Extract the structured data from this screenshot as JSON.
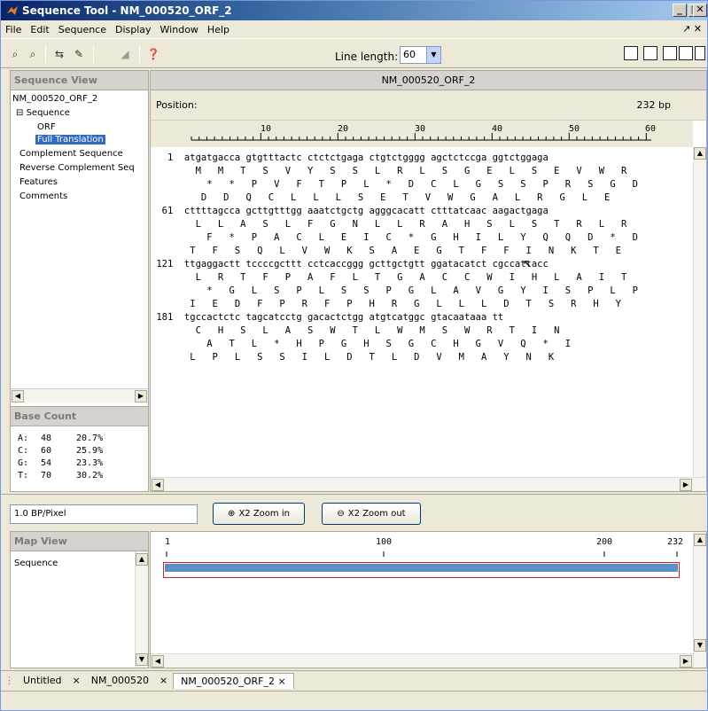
{
  "window": {
    "title": "Sequence Tool - NM_000520_ORF_2"
  },
  "menu": [
    "File",
    "Edit",
    "Sequence",
    "Display",
    "Window",
    "Help"
  ],
  "menu_right": "↗ ✕",
  "toolbar": {
    "line_length_label": "Line length:",
    "line_length_value": "60"
  },
  "sequence_view": {
    "header": "Sequence View",
    "tree": {
      "root": "NM_000520_ORF_2",
      "sequence": "Sequence",
      "orf": "ORF",
      "full_translation": "Full Translation",
      "complement": "Complement Sequence",
      "reverse_complement": "Reverse Complement Seq",
      "features": "Features",
      "comments": "Comments"
    }
  },
  "base_count": {
    "header": "Base Count",
    "rows": [
      {
        "base": "A:",
        "count": "48",
        "pct": "20.7%"
      },
      {
        "base": "C:",
        "count": "60",
        "pct": "25.9%"
      },
      {
        "base": "G:",
        "count": "54",
        "pct": "23.3%"
      },
      {
        "base": "T:",
        "count": "70",
        "pct": "30.2%"
      }
    ]
  },
  "main": {
    "seq_name": "NM_000520_ORF_2",
    "position_label": "Position:",
    "length": "232 bp",
    "ruler": [
      "10",
      "20",
      "30",
      "40",
      "50",
      "60"
    ],
    "lines": [
      "   1  atgatgacca gtgtttactc ctctctgaga ctgtctgggg agctctccga ggtctggaga",
      "        M   M   T   S   V   Y   S   S   L   R   L   S   G   E   L   S   E   V   W   R",
      "          *   *   P   V   F   T   P   L   *   D   C   L   G   S   S   P   R   S   G   D",
      "         D   D   Q   C   L   L   L   S   E   T   V   W   G   A   L   R   G   L   E",
      "  61  cttttagcca gcttgtttgg aaatctgctg agggcacatt ctttatcaac aagactgaga",
      "        L   L   A   S   L   F   G   N   L   L   R   A   H   S   L   S   T   R   L   R",
      "          F   *   P   A   C   L   E   I   C   *   G   H   I   L   Y   Q   Q   D   *   D",
      "       T   F   S   Q   L   V   W   K   S   A   E   G   T   F   F   I   N   K   T   E",
      " 121  ttgaggactt tccccgcttt cctcaccggg gcttgctgtt ggatacatct cgccattacc",
      "        L   R   T   F   P   A   F   L   T   G   A   C   C   W   I   H   L   A   I   T",
      "          *   G   L   S   P   L   S   S   P   G   L   A   V   G   Y   I   S   P   L   P",
      "       I   E   D   F   P   R   F   P   H   R   G   L   L   L   D   T   S   R   H   Y",
      " 181  tgccactctc tagcatcctg gacactctgg atgtcatggc gtacaataaa tt",
      "        C   H   S   L   A   S   W   T   L   W   M   S   W   R   T   I   N",
      "          A   T   L   *   H   P   G   H   S   G   C   H   G   V   Q   *   I",
      "       L   P   L   S   S   I   L   D   T   L   D   V   M   A   Y   N   K"
    ]
  },
  "zoom": {
    "bp_per_pixel": "1.0 BP/Pixel",
    "zoom_in": "X2 Zoom in",
    "zoom_out": "X2 Zoom out"
  },
  "map_view": {
    "header": "Map View",
    "item": "Sequence",
    "ruler": [
      "1",
      "100",
      "200",
      "232"
    ]
  },
  "tabs": [
    "Untitled",
    "NM_000520",
    "NM_000520_ORF_2"
  ],
  "tab_close": "×",
  "colors": {
    "red": "#d02020",
    "blue": "#1f57d0",
    "green": "#1e8a1e",
    "map_bar": "#5b8fc7"
  }
}
